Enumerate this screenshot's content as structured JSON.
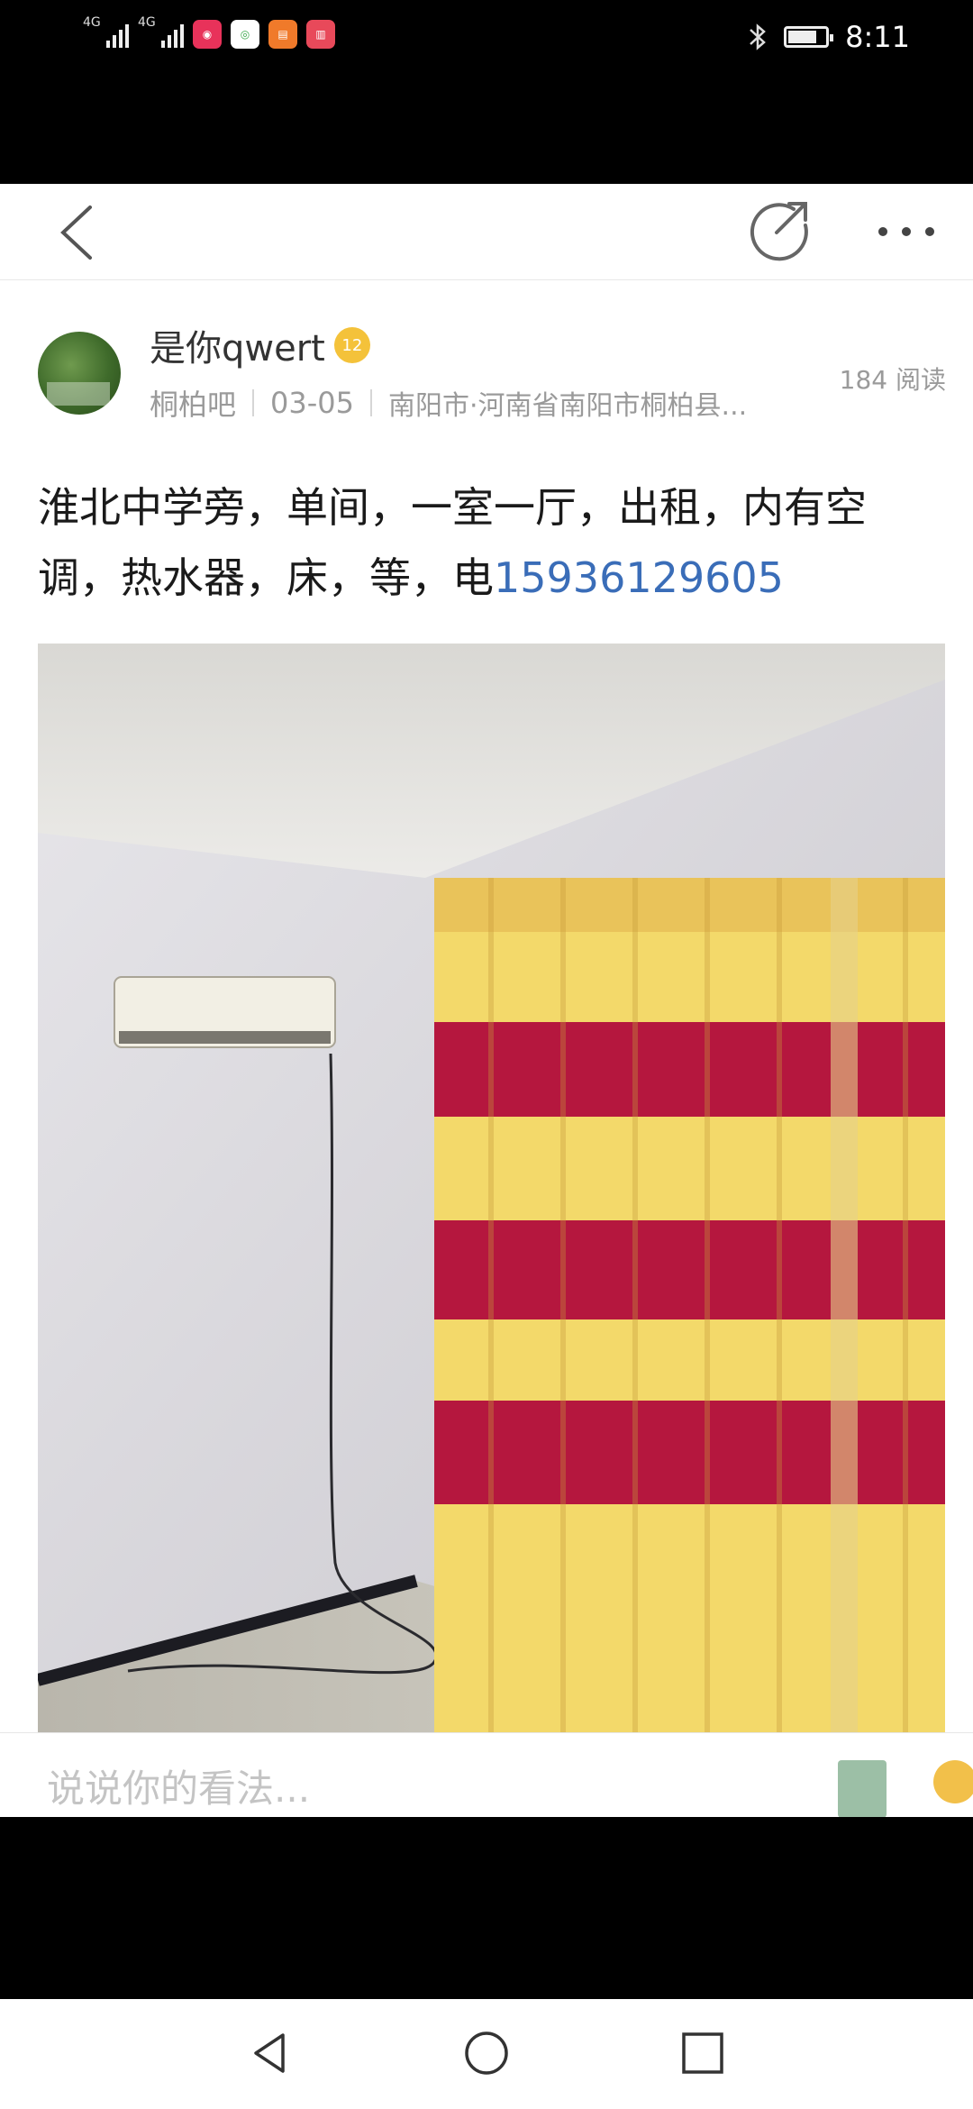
{
  "status_bar": {
    "sim1": "4G",
    "sim2": "4G",
    "time": "8:11"
  },
  "post": {
    "author_name": "是你qwert",
    "level": "12",
    "forum": "桐柏吧",
    "date": "03-05",
    "location": "南阳市·河南省南阳市桐柏县...",
    "reads": "184 阅读",
    "text_main": "淮北中学旁，单间，一室一厅，出租，内有空调，热水器，床，等，电",
    "phone": "15936129605"
  },
  "comment": {
    "placeholder": "说说你的看法..."
  },
  "icons": {
    "back": "back-chevron-icon",
    "share": "share-icon",
    "more": "more-dots-icon",
    "bluetooth": "bluetooth-icon",
    "battery": "battery-icon"
  },
  "colors": {
    "link": "#3a6db8",
    "level_badge": "#f4c23a"
  }
}
